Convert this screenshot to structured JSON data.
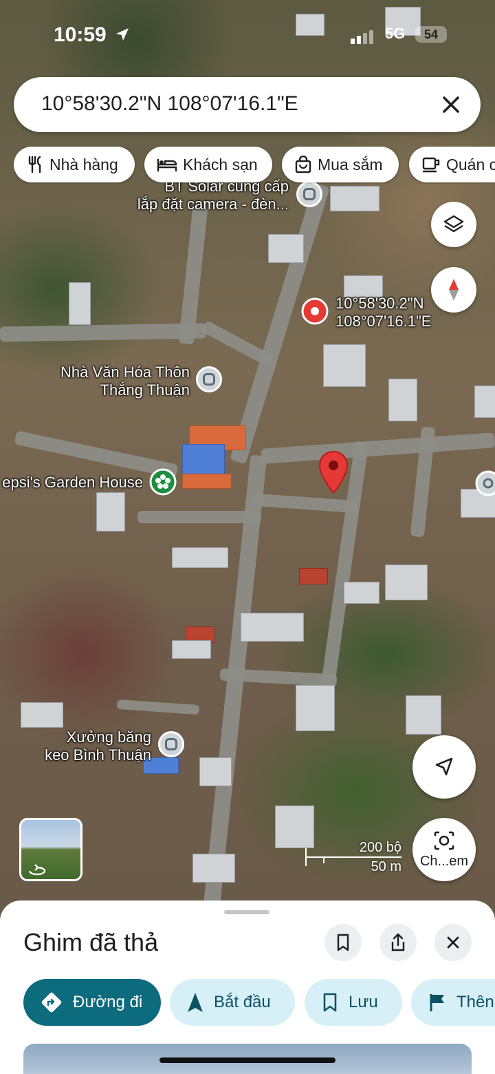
{
  "status_bar": {
    "time": "10:59",
    "network": "5G",
    "battery": "54"
  },
  "search": {
    "query": "10°58'30.2\"N 108°07'16.1\"E"
  },
  "chips": [
    {
      "label": "Nhà hàng",
      "icon": "restaurant-icon"
    },
    {
      "label": "Khách sạn",
      "icon": "hotel-icon"
    },
    {
      "label": "Mua sắm",
      "icon": "shopping-icon"
    },
    {
      "label": "Quán c",
      "icon": "cafe-icon"
    }
  ],
  "map": {
    "labels": {
      "solar": "BT Solar cung cấp\nlắp đặt camera - đèn...",
      "coord_line1": "10°58'30.2\"N",
      "coord_line2": "108°07'16.1\"E",
      "cultural_line1": "Nhà Văn Hóa Thôn",
      "cultural_line2": "Thắng Thuận",
      "garden": "epsi's Garden House",
      "tape_line1": "Xưởng băng",
      "tape_line2": "keo Bình Thuận"
    },
    "scale": {
      "feet": "200 bộ",
      "meters": "50 m"
    },
    "camera_button": "Ch...em"
  },
  "sheet": {
    "title": "Ghim đã thả",
    "actions": [
      {
        "label": "Đường đi",
        "icon": "directions-icon",
        "primary": true
      },
      {
        "label": "Bắt đầu",
        "icon": "navigation-start-icon",
        "primary": false
      },
      {
        "label": "Lưu",
        "icon": "bookmark-icon",
        "primary": false
      },
      {
        "label": "Thên",
        "icon": "flag-icon",
        "primary": false
      }
    ]
  },
  "colors": {
    "accent": "#0d6b7e",
    "pin_red": "#e53935",
    "chip_bg": "#ffffff",
    "action_bg": "#d7f0f8"
  }
}
